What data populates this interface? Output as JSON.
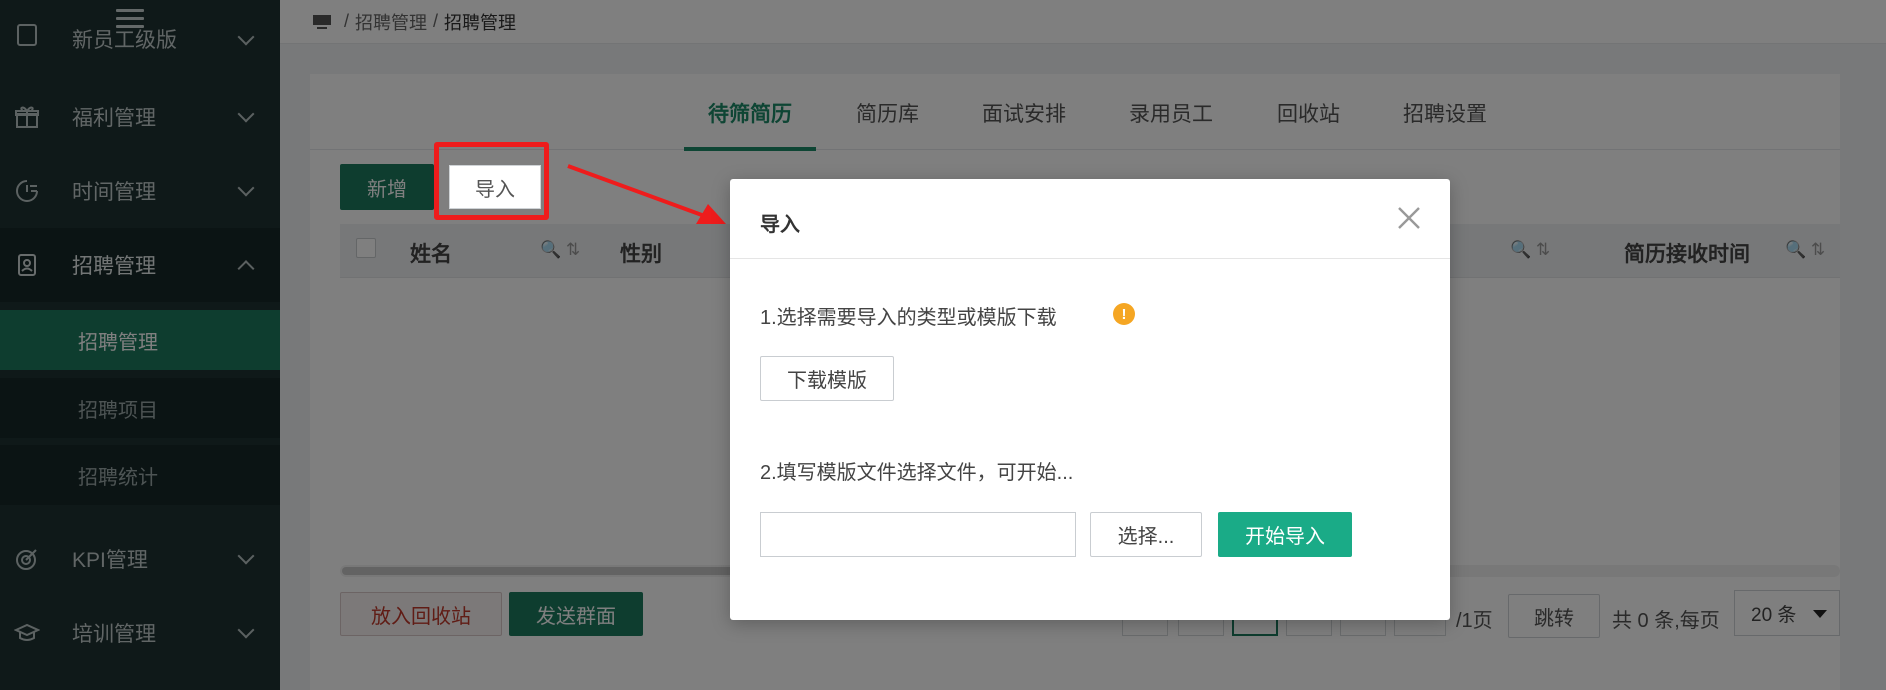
{
  "sidebar": {
    "top_partial_label": "新员工级版",
    "items": [
      {
        "label": "福利管理",
        "icon": "gift-icon"
      },
      {
        "label": "时间管理",
        "icon": "clock-icon"
      },
      {
        "label": "招聘管理",
        "icon": "badge-icon",
        "expanded": true
      },
      {
        "label": "KPI管理",
        "icon": "target-icon"
      },
      {
        "label": "培训管理",
        "icon": "graduation-cap-icon"
      }
    ],
    "sub_items": [
      {
        "label": "招聘管理",
        "active": true
      },
      {
        "label": "招聘项目"
      },
      {
        "label": "招聘统计"
      }
    ]
  },
  "breadcrumb": {
    "sep": "/",
    "parent": "招聘管理",
    "current": "招聘管理"
  },
  "tabs": [
    {
      "label": "待筛简历",
      "active": true
    },
    {
      "label": "简历库"
    },
    {
      "label": "面试安排"
    },
    {
      "label": "录用员工"
    },
    {
      "label": "回收站"
    },
    {
      "label": "招聘设置"
    }
  ],
  "toolbar": {
    "add_label": "新增",
    "import_label": "导入"
  },
  "table": {
    "columns": [
      "姓名",
      "性别",
      "简历接收时间"
    ],
    "sort_icons": "🔍 ⇅"
  },
  "footer": {
    "recycle_label": "放入回收站",
    "group_interview_label": "发送群面",
    "page_total": "/1页",
    "jump_label": "跳转",
    "summary": "共 0 条,每页",
    "page_size": "20 条"
  },
  "modal": {
    "title": "导入",
    "step1": "1.选择需要导入的类型或模版下载",
    "download_label": "下载模版",
    "step2": "2.填写模版文件选择文件，可开始...",
    "file_value": "",
    "choose_label": "选择...",
    "start_label": "开始导入"
  },
  "colors": {
    "sidebar_bg": "#1e3232",
    "accent_green": "#1c7a5f",
    "modal_green": "#1aab87",
    "highlight_red": "#ee1c1c",
    "warn_orange": "#f5a623"
  }
}
